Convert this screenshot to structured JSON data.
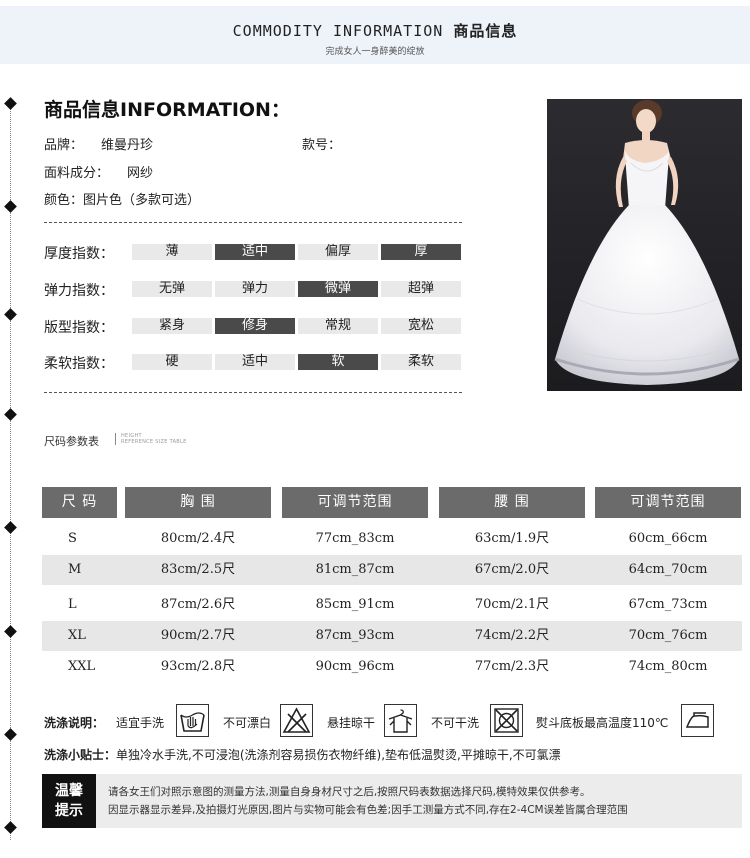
{
  "banner": {
    "title_en": "COMMODITY INFORMATION",
    "title_cn": "商品信息",
    "subtitle": "完成女人一身醉美的绽放"
  },
  "section_title": "商品信息INFORMATION：",
  "product": {
    "brand_label": "品牌：",
    "brand_value": "维曼丹珍",
    "style_label": "款号：",
    "style_value": "",
    "fabric_label": "面料成分：",
    "fabric_value": "网纱",
    "color_label": "颜色：",
    "color_value": "图片色（多款可选）"
  },
  "metrics": [
    {
      "label": "厚度指数：",
      "options": [
        "薄",
        "适中",
        "偏厚",
        "厚"
      ],
      "selected": [
        1,
        3
      ]
    },
    {
      "label": "弹力指数：",
      "options": [
        "无弹",
        "弹力",
        "微弹",
        "超弹"
      ],
      "selected": [
        2
      ]
    },
    {
      "label": "版型指数：",
      "options": [
        "紧身",
        "修身",
        "常规",
        "宽松"
      ],
      "selected": [
        1
      ]
    },
    {
      "label": "柔软指数：",
      "options": [
        "硬",
        "适中",
        "软",
        "柔软"
      ],
      "selected": [
        2
      ]
    }
  ],
  "size_section": {
    "title": "尺码参数表",
    "subtitle_line1": "HEIGHT",
    "subtitle_line2": "REFERENCE SIZE TABLE"
  },
  "size_table": {
    "headers": [
      "尺 码",
      "胸 围",
      "可调节范围",
      "腰 围",
      "可调节范围"
    ],
    "rows": [
      [
        "S",
        "80cm/2.4尺",
        "77cm_83cm",
        "63cm/1.9尺",
        "60cm_66cm"
      ],
      [
        "M",
        "83cm/2.5尺",
        "81cm_87cm",
        "67cm/2.0尺",
        "64cm_70cm"
      ],
      [
        "L",
        "87cm/2.6尺",
        "85cm_91cm",
        "70cm/2.1尺",
        "67cm_73cm"
      ],
      [
        "XL",
        "90cm/2.7尺",
        "87cm_93cm",
        "74cm/2.2尺",
        "70cm_76cm"
      ],
      [
        "XXL",
        "93cm/2.8尺",
        "90cm_96cm",
        "77cm/2.3尺",
        "74cm_80cm"
      ]
    ]
  },
  "wash": {
    "label": "洗涤说明：",
    "items": [
      {
        "text": "适宜手洗",
        "icon": "hand-wash-icon"
      },
      {
        "text": "不可漂白",
        "icon": "no-bleach-icon"
      },
      {
        "text": "悬挂晾干",
        "icon": "hang-dry-icon"
      },
      {
        "text": "不可干洗",
        "icon": "no-dry-clean-icon"
      },
      {
        "text": "熨斗底板最高温度110℃",
        "icon": "iron-icon"
      }
    ]
  },
  "tips": {
    "label": "洗涤小贴士：",
    "text": "单独冷水手洗,不可浸泡(洗涤剂容易损伤衣物纤维),垫布低温熨烫,平摊晾干,不可氯漂"
  },
  "notice": {
    "tag_line1": "温馨",
    "tag_line2": "提示",
    "line1": "请各女王们对照示意图的测量方法,测量自身身材尺寸之后,按照尺码表数据选择尺码,模特效果仅供参考。",
    "line2": "因显示器显示差异,及拍摄灯光原因,图片与实物可能会有色差;因手工测量方式不同,存在2-4CM误差皆属合理范围"
  },
  "colors": {
    "banner_bg": "#eef3fa",
    "header_gray": "#6b6b6b",
    "selected_cell": "#4a4a4a",
    "unselected_cell": "#e9e9e9",
    "row_shade": "#e7e7e7"
  }
}
